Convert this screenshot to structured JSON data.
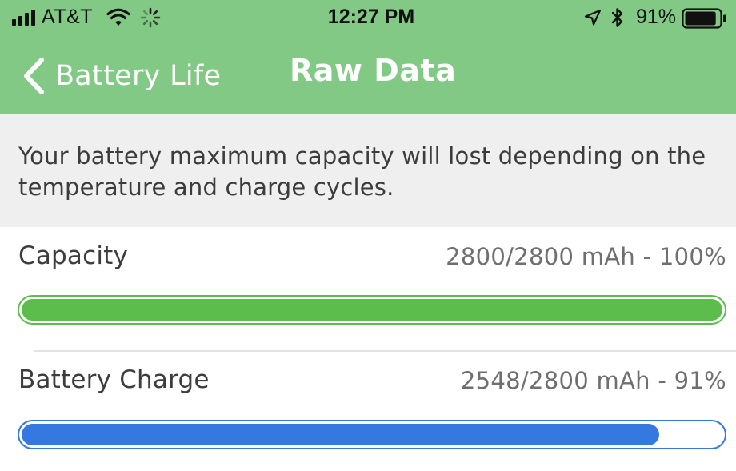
{
  "status_bar": {
    "carrier": "AT&T",
    "time": "12:27 PM",
    "battery_percent": "91%",
    "icons": [
      "signal-bars-icon",
      "wifi-icon",
      "activity-spinner-icon",
      "location-arrow-icon",
      "bluetooth-icon",
      "battery-icon"
    ],
    "battery_level": 0.91
  },
  "nav": {
    "back_label": "Battery Life",
    "title": "Raw Data",
    "bar_color": "#82c986"
  },
  "info": {
    "text": "Your battery maximum capacity will lost depending on the temperature and charge cycles."
  },
  "rows": [
    {
      "label": "Capacity",
      "value": "2800/2800 mAh - 100%",
      "level": 1.0,
      "fill_color": "#5cbd4c",
      "border_color": "#5cbd4c"
    },
    {
      "label": "Battery Charge",
      "value": "2548/2800 mAh - 91%",
      "level": 0.91,
      "fill_color": "#3478e0",
      "border_color": "#3478e0"
    }
  ]
}
